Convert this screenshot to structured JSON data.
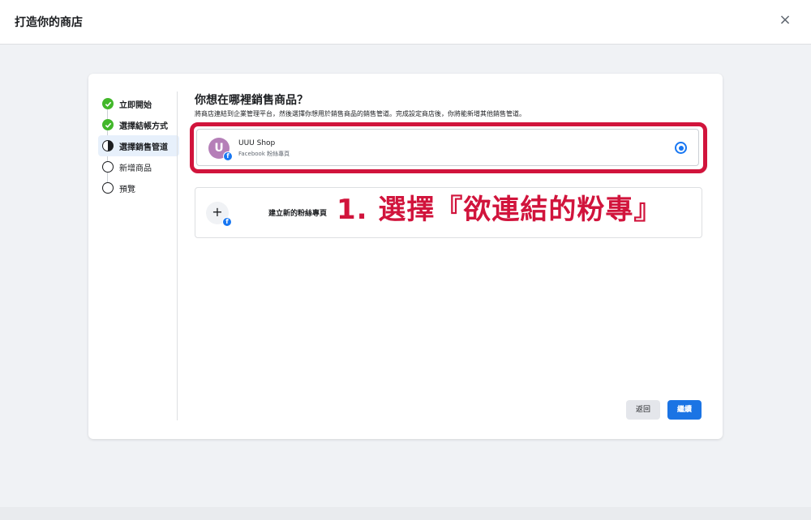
{
  "header": {
    "title": "打造你的商店",
    "close_icon": "×"
  },
  "steps": [
    {
      "label": "立即開始",
      "state": "done"
    },
    {
      "label": "選擇結帳方式",
      "state": "done"
    },
    {
      "label": "選擇銷售管道",
      "state": "current"
    },
    {
      "label": "新增商品",
      "state": "todo"
    },
    {
      "label": "預覽",
      "state": "todo"
    }
  ],
  "main": {
    "heading": "你想在哪裡銷售商品？",
    "description": "將商店連結到企業管理平台，然後選擇你想用於銷售商品的銷售管道。完成設定商店後，你將能新增其他銷售管道。",
    "selected_option": {
      "avatar_letter": "U",
      "name": "UUU Shop",
      "subtitle": "Facebook 粉絲專頁",
      "selected": true
    },
    "new_option": {
      "icon": "+",
      "label": "建立新的粉絲專頁"
    },
    "annotation": "1. 選擇『欲連結的粉專』"
  },
  "footer": {
    "back_label": "返回",
    "next_label": "繼續"
  },
  "colors": {
    "accent": "#1b74e4",
    "annotation": "#d1143c",
    "done": "#42b72a"
  }
}
